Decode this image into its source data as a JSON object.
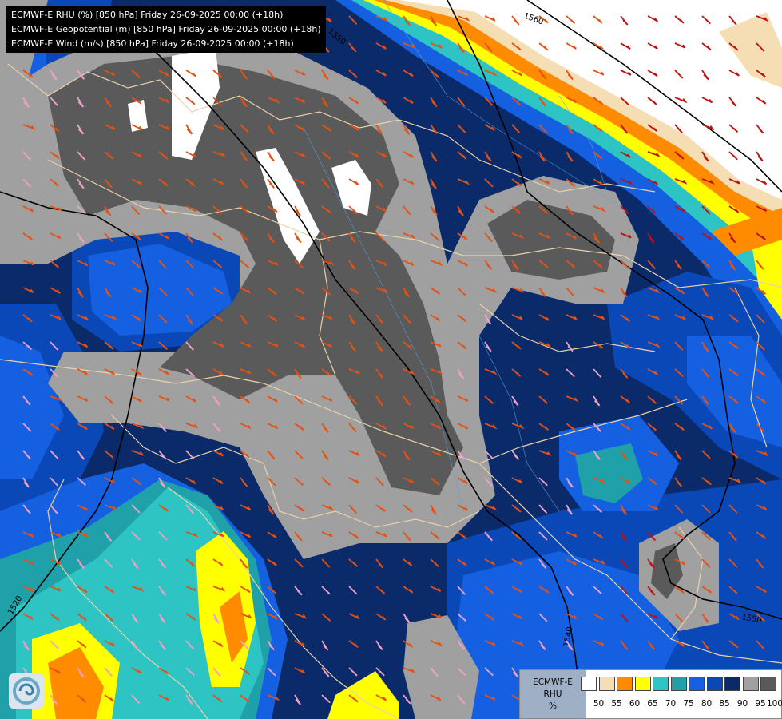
{
  "titles": [
    "ECMWF-E RHU (%) [850 hPa] Friday 26-09-2025 00:00 (+18h)",
    "ECMWF-E Geopotential (m) [850 hPa] Friday 26-09-2025 00:00 (+18h)",
    "ECMWF-E Wind (m/s) [850 hPa] Friday 26-09-2025 00:00 (+18h)"
  ],
  "contour_labels": [
    "1560",
    "1550",
    "1520",
    "1540",
    "1550"
  ],
  "legend": {
    "model": "ECMWF-E",
    "variable": "RHU",
    "unit": "%",
    "colors": [
      "#ffffff",
      "#f5deb3",
      "#ff8c00",
      "#ffff00",
      "#2ec4c4",
      "#20a0a8",
      "#1560e0",
      "#0a48b8",
      "#0a2a6a",
      "#a0a0a0",
      "#5a5a5a"
    ],
    "ticks": [
      "50",
      "55",
      "60",
      "65",
      "70",
      "75",
      "80",
      "85",
      "90",
      "95",
      "100"
    ]
  },
  "colors": {
    "rhu_100": "#5a5a5a",
    "rhu_95": "#a0a0a0",
    "rhu_90": "#0a2a6a",
    "rhu_85": "#0a48b8",
    "rhu_80": "#1560e0",
    "rhu_75": "#20a0a8",
    "rhu_70": "#2ec4c4",
    "rhu_65": "#ffff00",
    "rhu_60": "#ff8c00",
    "rhu_55": "#f5deb3",
    "rhu_50": "#ffffff",
    "wind_barb_strong": "#e85010",
    "wind_barb_weak": "#f0a0c8",
    "wind_barb_very_strong": "#c01010",
    "border": "#e8d2a8"
  }
}
